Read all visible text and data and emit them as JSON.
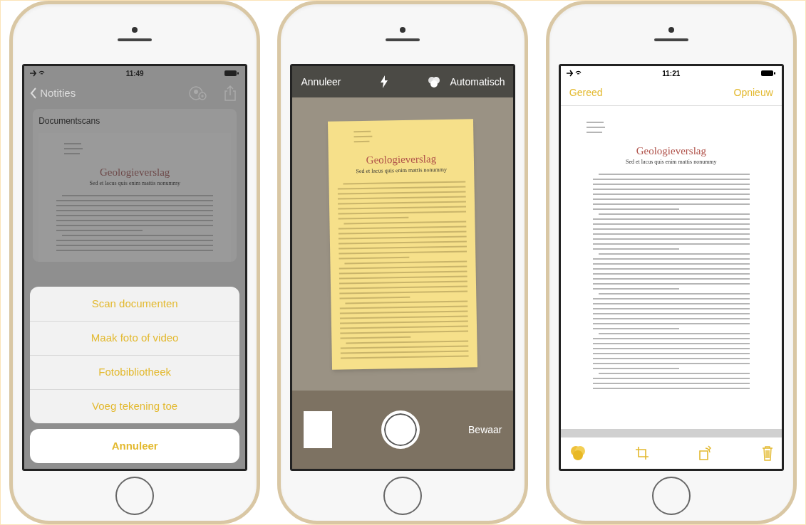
{
  "phones": [
    {
      "kind": "notes",
      "status_bar": {
        "time": "11:49"
      },
      "nav": {
        "back": "Notities"
      },
      "card_title": "Documentscans",
      "document": {
        "title": "Geologieverslag",
        "subtitle": "Sed et lacus quis enim mattis nonummy"
      },
      "action_sheet": {
        "items": [
          "Scan documenten",
          "Maak foto of video",
          "Fotobibliotheek",
          "Voeg tekening toe"
        ],
        "cancel": "Annuleer"
      }
    },
    {
      "kind": "camera",
      "top_bar": {
        "cancel": "Annuleer",
        "filter": "Automatisch"
      },
      "document": {
        "title": "Geologieverslag",
        "subtitle": "Sed et lacus quis enim mattis nonummy"
      },
      "save": "Bewaar"
    },
    {
      "kind": "editor",
      "status_bar": {
        "time": "11:21"
      },
      "nav": {
        "done": "Gereed",
        "retake": "Opnieuw"
      },
      "document": {
        "title": "Geologieverslag",
        "subtitle": "Sed et lacus quis enim mattis nonummy"
      }
    }
  ]
}
